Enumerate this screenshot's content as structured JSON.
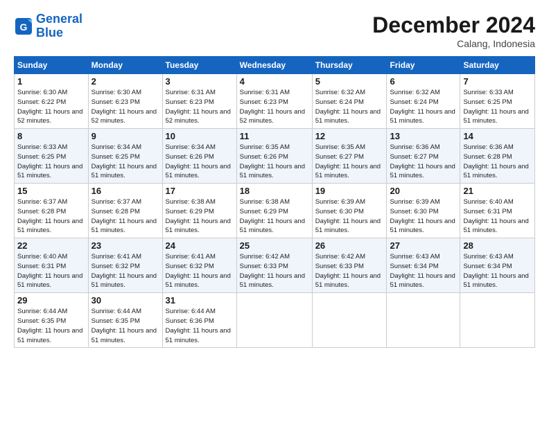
{
  "logo": {
    "line1": "General",
    "line2": "Blue"
  },
  "title": "December 2024",
  "subtitle": "Calang, Indonesia",
  "headers": [
    "Sunday",
    "Monday",
    "Tuesday",
    "Wednesday",
    "Thursday",
    "Friday",
    "Saturday"
  ],
  "weeks": [
    [
      {
        "day": "1",
        "sunrise": "6:30 AM",
        "sunset": "6:22 PM",
        "daylight": "11 hours and 52 minutes."
      },
      {
        "day": "2",
        "sunrise": "6:30 AM",
        "sunset": "6:23 PM",
        "daylight": "11 hours and 52 minutes."
      },
      {
        "day": "3",
        "sunrise": "6:31 AM",
        "sunset": "6:23 PM",
        "daylight": "11 hours and 52 minutes."
      },
      {
        "day": "4",
        "sunrise": "6:31 AM",
        "sunset": "6:23 PM",
        "daylight": "11 hours and 52 minutes."
      },
      {
        "day": "5",
        "sunrise": "6:32 AM",
        "sunset": "6:24 PM",
        "daylight": "11 hours and 51 minutes."
      },
      {
        "day": "6",
        "sunrise": "6:32 AM",
        "sunset": "6:24 PM",
        "daylight": "11 hours and 51 minutes."
      },
      {
        "day": "7",
        "sunrise": "6:33 AM",
        "sunset": "6:25 PM",
        "daylight": "11 hours and 51 minutes."
      }
    ],
    [
      {
        "day": "8",
        "sunrise": "6:33 AM",
        "sunset": "6:25 PM",
        "daylight": "11 hours and 51 minutes."
      },
      {
        "day": "9",
        "sunrise": "6:34 AM",
        "sunset": "6:25 PM",
        "daylight": "11 hours and 51 minutes."
      },
      {
        "day": "10",
        "sunrise": "6:34 AM",
        "sunset": "6:26 PM",
        "daylight": "11 hours and 51 minutes."
      },
      {
        "day": "11",
        "sunrise": "6:35 AM",
        "sunset": "6:26 PM",
        "daylight": "11 hours and 51 minutes."
      },
      {
        "day": "12",
        "sunrise": "6:35 AM",
        "sunset": "6:27 PM",
        "daylight": "11 hours and 51 minutes."
      },
      {
        "day": "13",
        "sunrise": "6:36 AM",
        "sunset": "6:27 PM",
        "daylight": "11 hours and 51 minutes."
      },
      {
        "day": "14",
        "sunrise": "6:36 AM",
        "sunset": "6:28 PM",
        "daylight": "11 hours and 51 minutes."
      }
    ],
    [
      {
        "day": "15",
        "sunrise": "6:37 AM",
        "sunset": "6:28 PM",
        "daylight": "11 hours and 51 minutes."
      },
      {
        "day": "16",
        "sunrise": "6:37 AM",
        "sunset": "6:28 PM",
        "daylight": "11 hours and 51 minutes."
      },
      {
        "day": "17",
        "sunrise": "6:38 AM",
        "sunset": "6:29 PM",
        "daylight": "11 hours and 51 minutes."
      },
      {
        "day": "18",
        "sunrise": "6:38 AM",
        "sunset": "6:29 PM",
        "daylight": "11 hours and 51 minutes."
      },
      {
        "day": "19",
        "sunrise": "6:39 AM",
        "sunset": "6:30 PM",
        "daylight": "11 hours and 51 minutes."
      },
      {
        "day": "20",
        "sunrise": "6:39 AM",
        "sunset": "6:30 PM",
        "daylight": "11 hours and 51 minutes."
      },
      {
        "day": "21",
        "sunrise": "6:40 AM",
        "sunset": "6:31 PM",
        "daylight": "11 hours and 51 minutes."
      }
    ],
    [
      {
        "day": "22",
        "sunrise": "6:40 AM",
        "sunset": "6:31 PM",
        "daylight": "11 hours and 51 minutes."
      },
      {
        "day": "23",
        "sunrise": "6:41 AM",
        "sunset": "6:32 PM",
        "daylight": "11 hours and 51 minutes."
      },
      {
        "day": "24",
        "sunrise": "6:41 AM",
        "sunset": "6:32 PM",
        "daylight": "11 hours and 51 minutes."
      },
      {
        "day": "25",
        "sunrise": "6:42 AM",
        "sunset": "6:33 PM",
        "daylight": "11 hours and 51 minutes."
      },
      {
        "day": "26",
        "sunrise": "6:42 AM",
        "sunset": "6:33 PM",
        "daylight": "11 hours and 51 minutes."
      },
      {
        "day": "27",
        "sunrise": "6:43 AM",
        "sunset": "6:34 PM",
        "daylight": "11 hours and 51 minutes."
      },
      {
        "day": "28",
        "sunrise": "6:43 AM",
        "sunset": "6:34 PM",
        "daylight": "11 hours and 51 minutes."
      }
    ],
    [
      {
        "day": "29",
        "sunrise": "6:44 AM",
        "sunset": "6:35 PM",
        "daylight": "11 hours and 51 minutes."
      },
      {
        "day": "30",
        "sunrise": "6:44 AM",
        "sunset": "6:35 PM",
        "daylight": "11 hours and 51 minutes."
      },
      {
        "day": "31",
        "sunrise": "6:44 AM",
        "sunset": "6:36 PM",
        "daylight": "11 hours and 51 minutes."
      },
      null,
      null,
      null,
      null
    ]
  ]
}
